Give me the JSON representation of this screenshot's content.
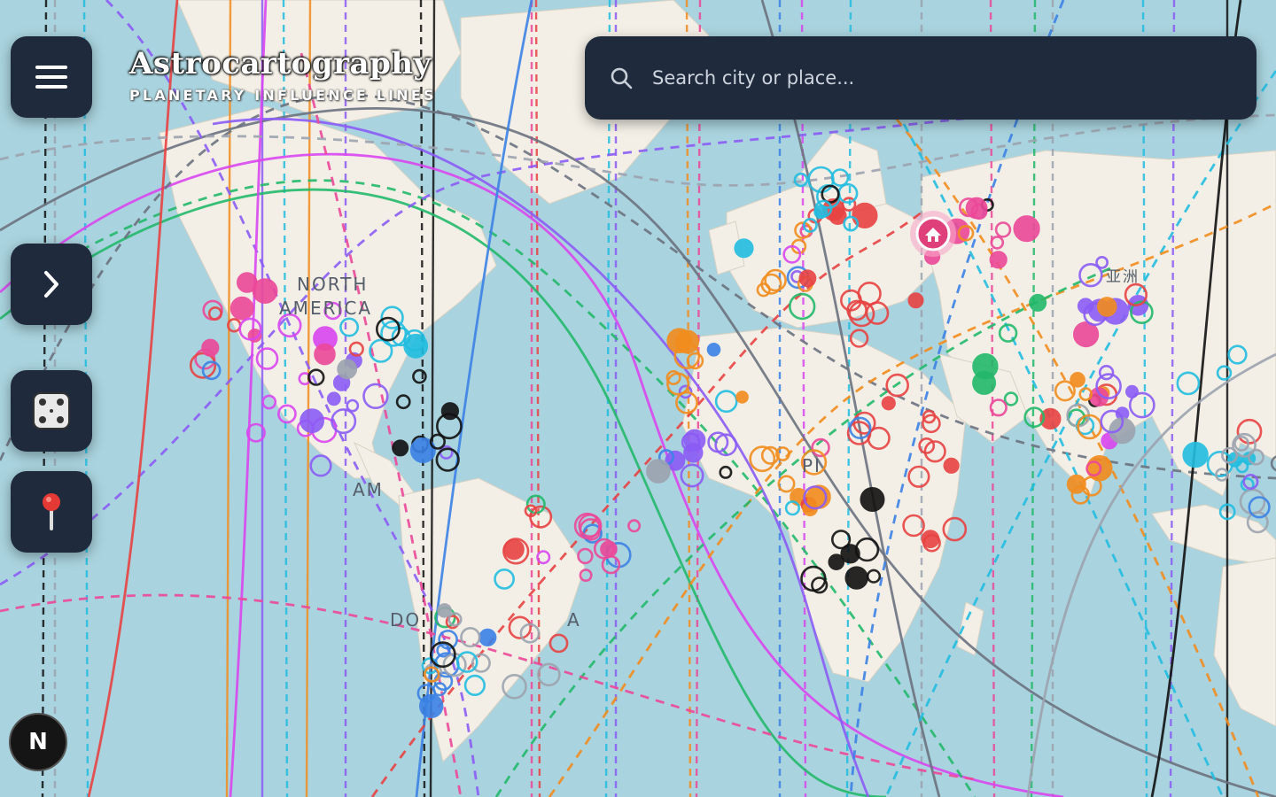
{
  "app": {
    "title": "Astrocartography",
    "subtitle": "PLANETARY INFLUENCE LINES"
  },
  "search": {
    "placeholder": "Search city or place..."
  },
  "toolbar": {
    "menu_icon": "hamburger-menu-icon",
    "expand_icon": "chevron-right-icon",
    "dice_icon": "dice-icon",
    "pin_icon": "map-pin-icon"
  },
  "badge": {
    "label": "N"
  },
  "map": {
    "labels": [
      "NORTH",
      "AMERICA",
      "AM",
      "DO",
      "A",
      "PI",
      "亚洲"
    ],
    "home_marker_icon": "home-icon",
    "colors": {
      "ocean": "#a9d3de",
      "land": "#f3efe6",
      "panel": "#1f2a3d",
      "home_marker": "#e0407a"
    },
    "line_colors": [
      "#e84343",
      "#f28c1e",
      "#3b82e6",
      "#8b5cf6",
      "#d946ef",
      "#22b86a",
      "#22bde0",
      "#ec4899",
      "#6b7280",
      "#111111",
      "#9ca3af"
    ]
  }
}
